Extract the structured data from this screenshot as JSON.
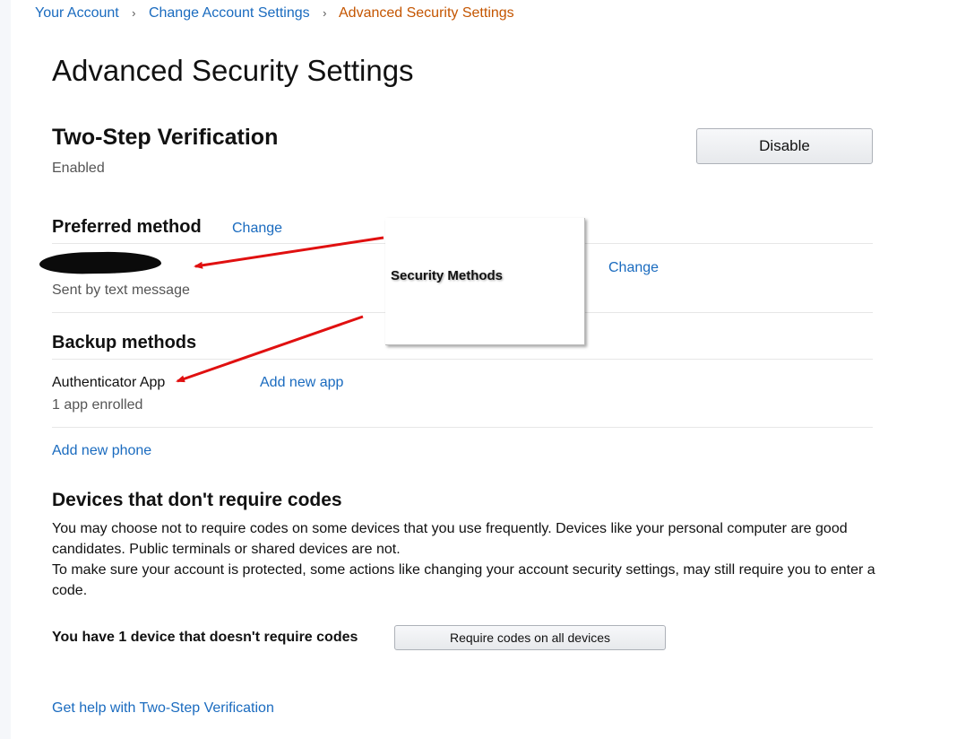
{
  "breadcrumb": {
    "items": [
      "Your Account",
      "Change Account Settings"
    ],
    "current": "Advanced Security Settings",
    "separator": "›"
  },
  "page": {
    "title": "Advanced Security Settings"
  },
  "two_step": {
    "heading": "Two-Step Verification",
    "status": "Enabled",
    "disable_button": "Disable"
  },
  "preferred": {
    "heading": "Preferred method",
    "change_link": "Change",
    "method_detail": "Sent by text message",
    "row_change_link": "Change"
  },
  "backup": {
    "heading": "Backup methods",
    "app_name": "Authenticator App",
    "app_count": "1 app enrolled",
    "add_app_link": "Add new app",
    "add_phone_link": "Add new phone"
  },
  "callout": {
    "label": "Security Methods"
  },
  "devices": {
    "heading": "Devices that don't require codes",
    "paragraph1": "You may choose not to require codes on some devices that you use frequently. Devices like your personal computer are good candidates. Public terminals or shared devices are not.",
    "paragraph2": "To make sure your account is protected, some actions like changing your account security settings, may still require you to enter a code.",
    "count_text": "You have 1 device that doesn't require codes",
    "require_button": "Require codes on all devices"
  },
  "help": {
    "link": "Get help with Two-Step Verification"
  },
  "colors": {
    "link": "#1a6bbf",
    "breadcrumb_current": "#c45500",
    "annotation_arrow": "#e01010"
  }
}
